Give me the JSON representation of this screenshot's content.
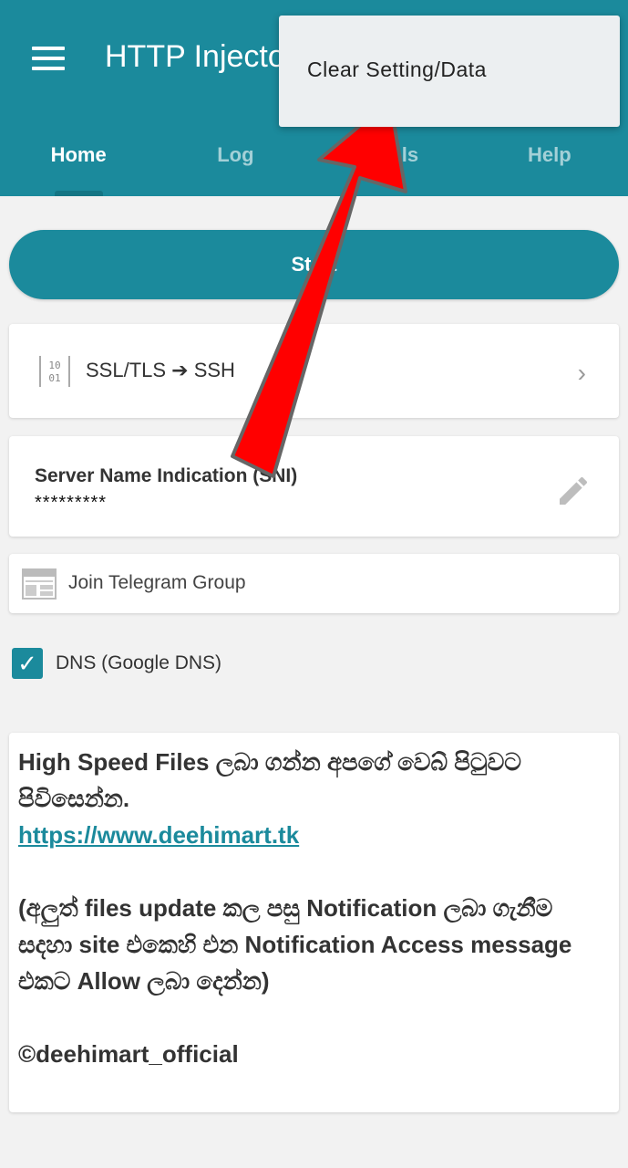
{
  "app": {
    "title": "HTTP Injector"
  },
  "tabs": [
    "Home",
    "Log",
    "Tools",
    "Help"
  ],
  "start_button": {
    "label": "Start"
  },
  "ssl_card": {
    "icon_text": "1 0\n0 1",
    "label": "SSL/TLS ➔ SSH"
  },
  "sni_card": {
    "title": "Server Name Indication (SNI)",
    "value": "*********"
  },
  "telegram_card": {
    "label": "Join Telegram Group"
  },
  "dns": {
    "label": "DNS (Google DNS)",
    "checked": true
  },
  "message": {
    "line1": "High Speed Files ලබා ගන්න අපගේ වෙබ් පිටුවට පිවිසෙන්න.",
    "link": "https://www.deehimart.tk",
    "line2": "(අලුත් files update කල පසු Notification ලබා ගැනීම සදහා site එකෙහි එන Notification Access message එකට Allow ලබා දෙන්න)",
    "footer": "©deehimart_official"
  },
  "dropdown": {
    "item": "Clear Setting/Data"
  },
  "colors": {
    "primary": "#1b8a9c",
    "arrow": "#ff0000"
  },
  "icons": [
    "menu-icon",
    "binary-icon",
    "chevron-right-icon",
    "pencil-icon",
    "calendar-icon",
    "check-icon",
    "red-arrow-annotation"
  ]
}
